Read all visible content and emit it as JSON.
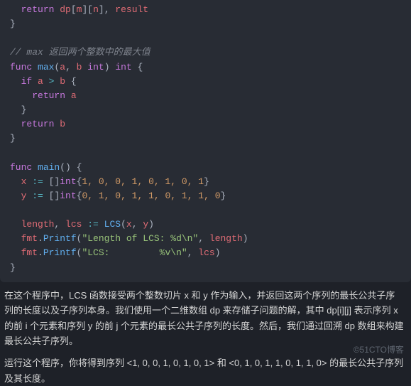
{
  "code": {
    "l1": "dp",
    "l1b": "m",
    "l1c": "n",
    "l1d": "result",
    "cm": "// max 返回两个整数中的最大值",
    "kw_func": "func",
    "fn_max": "max",
    "arg_a": "a",
    "arg_b": "b",
    "ty_int": "int",
    "kw_if": "if",
    "kw_return": "return",
    "fn_main": "main",
    "id_x": "x",
    "id_y": "y",
    "lit_x": "1, 0, 0, 1, 0, 1, 0, 1",
    "lit_y": "0, 1, 0, 1, 1, 0, 1, 1, 0",
    "id_len": "length",
    "id_lcs": "lcs",
    "fn_LCS": "LCS",
    "id_fmt": "fmt",
    "fn_Printf": "Printf",
    "str1": "\"Length of LCS: %d\\n\"",
    "str2": "\"LCS:         %v\\n\""
  },
  "article": {
    "p1": "在这个程序中，LCS 函数接受两个整数切片 x 和 y 作为输入，并返回这两个序列的最长公共子序列的长度以及子序列本身。我们使用一个二维数组 dp 来存储子问题的解，其中 dp[i][j] 表示序列 x 的前 i 个元素和序列 y 的前 j 个元素的最长公共子序列的长度。然后，我们通过回溯 dp 数组来构建最长公共子序列。",
    "p2": "运行这个程序，你将得到序列 <1, 0, 0, 1, 0, 1, 0, 1> 和 <0, 1, 0, 1, 1, 0, 1, 1, 0> 的最长公共子序列及其长度。"
  },
  "watermark": "©51CTO博客"
}
